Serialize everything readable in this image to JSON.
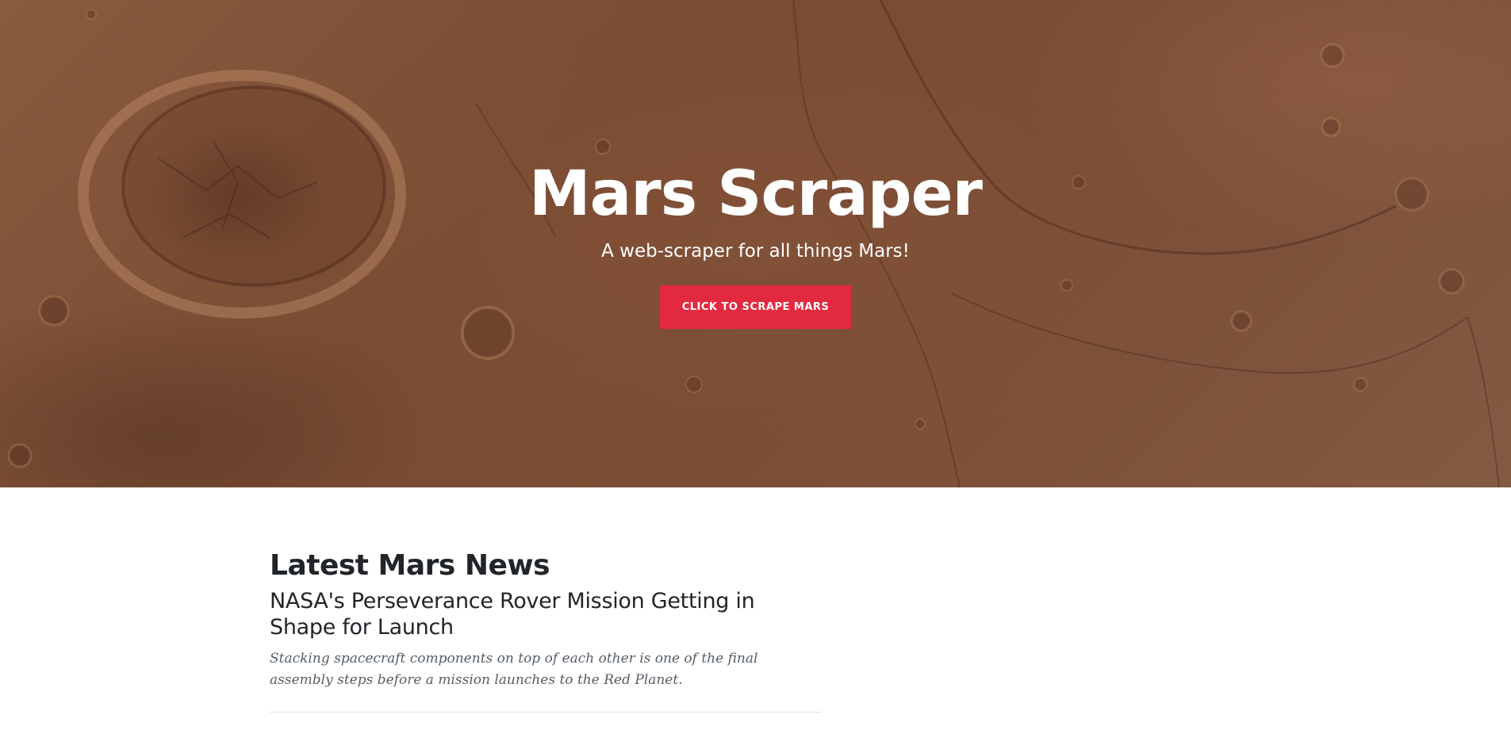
{
  "hero": {
    "title": "Mars Scraper",
    "subtitle": "A web-scraper for all things Mars!",
    "button_label": "CLICK TO SCRAPE MARS",
    "button_color": "#e3293f",
    "background_description_color": "#7b4d35"
  },
  "news": {
    "heading": "Latest Mars News",
    "title": "NASA's Perseverance Rover Mission Getting in Shape for Launch",
    "teaser": "Stacking spacecraft components on top of each other is one of the final assembly steps before a mission launches to the Red Planet."
  }
}
